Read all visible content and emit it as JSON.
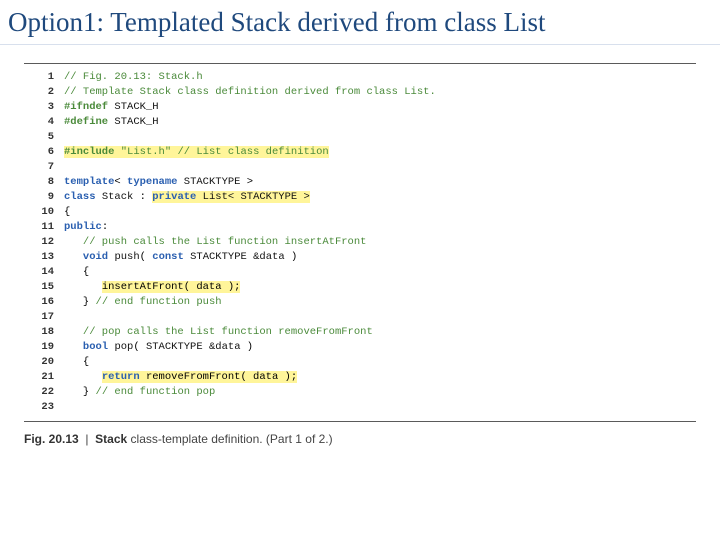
{
  "title": "Option1: Templated Stack derived from class List",
  "code": [
    {
      "n": "1",
      "comment": "// Fig. 20.13: Stack.h"
    },
    {
      "n": "2",
      "comment": "// Template Stack class definition derived from class List."
    },
    {
      "n": "3",
      "pre": "#ifndef",
      "macro": "STACK_H"
    },
    {
      "n": "4",
      "pre": "#define",
      "macro": "STACK_H"
    },
    {
      "n": "5"
    },
    {
      "n": "6",
      "pre": "#include",
      "str": "\"List.h\"",
      "comment": "// List class definition"
    },
    {
      "n": "7"
    },
    {
      "n": "8",
      "kw1": "template",
      "kw2": "typename",
      "type": "STACKTYPE"
    },
    {
      "n": "9",
      "kw1": "class",
      "name": "Stack",
      "kw2": "private",
      "base": "List< STACKTYPE >"
    },
    {
      "n": "10",
      "txt": "{"
    },
    {
      "n": "11",
      "kw": "public"
    },
    {
      "n": "12",
      "comment": "// push calls the List function insertAtFront"
    },
    {
      "n": "13",
      "kw1": "void",
      "fn": "push",
      "kw2": "const",
      "type": "STACKTYPE",
      "arg": "&data"
    },
    {
      "n": "14",
      "txt": "{"
    },
    {
      "n": "15",
      "hl": "insertAtFront( data );"
    },
    {
      "n": "16",
      "txt": "}",
      "comment": "// end function push"
    },
    {
      "n": "17"
    },
    {
      "n": "18",
      "comment": "// pop calls the List function removeFromFront"
    },
    {
      "n": "19",
      "kw": "bool",
      "fn": "pop",
      "type": "STACKTYPE",
      "arg": "&data"
    },
    {
      "n": "20",
      "txt": "{"
    },
    {
      "n": "21",
      "kw": "return",
      "call": "removeFromFront( data );"
    },
    {
      "n": "22",
      "txt": "}",
      "comment": "// end function pop"
    },
    {
      "n": "23"
    }
  ],
  "caption": {
    "fig": "Fig. 20.13",
    "bold": "Stack",
    "rest": "class-template definition. (Part 1 of 2.)"
  }
}
